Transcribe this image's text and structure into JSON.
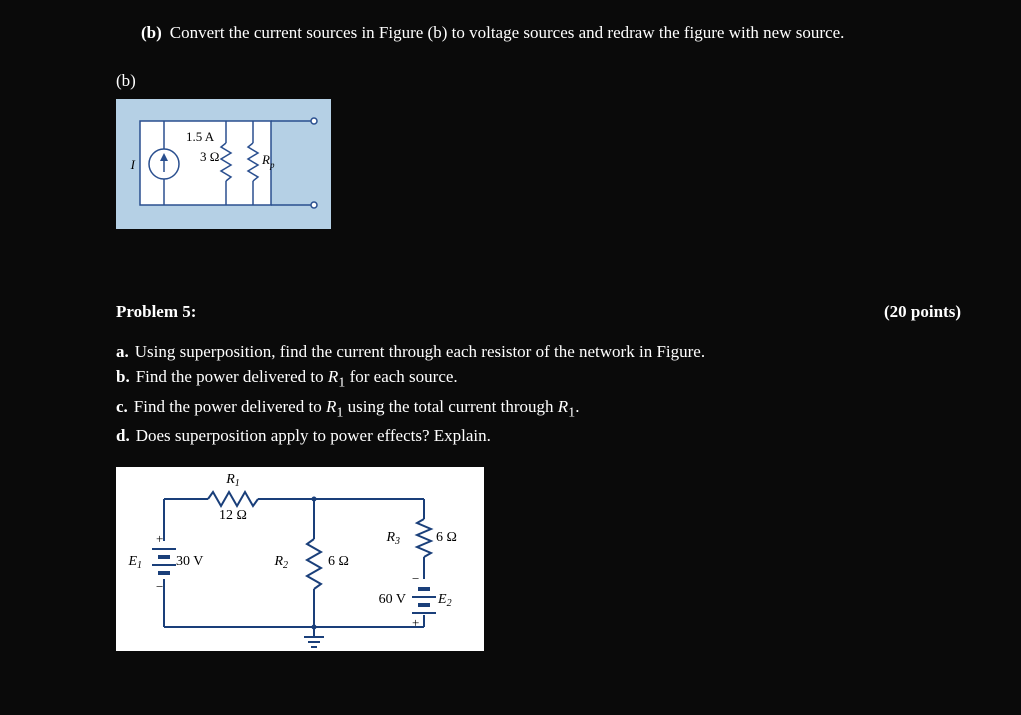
{
  "partB": {
    "tag": "(b)",
    "text": "Convert the current sources in Figure (b) to voltage sources and redraw the figure with new source."
  },
  "figLabelB": "(b)",
  "figureB": {
    "currentLabel": "1.5 A",
    "srcLabel": "I",
    "resistorValue": "3 Ω",
    "resistorName": "R",
    "resistorSub": "p"
  },
  "problem5": {
    "title": "Problem 5:",
    "pointsUnderline": "   ",
    "points": "(20 points)",
    "a": {
      "tag": "a.",
      "text": "Using superposition, find the current through each resistor of the network in Figure."
    },
    "b": {
      "tag": "b.",
      "text_pre": "Find the power delivered to ",
      "r1": "R",
      "r1sub": "1",
      "text_post": " for each source."
    },
    "c": {
      "tag": "c.",
      "text_pre": "Find the power delivered to ",
      "r1": "R",
      "r1sub": "1",
      "text_mid": " using the total current through ",
      "r1b": "R",
      "r1bsub": "1",
      "text_post": "."
    },
    "d": {
      "tag": "d.",
      "text": "Does superposition apply to power effects? Explain."
    }
  },
  "figureP5": {
    "R1": "R",
    "R1sub": "1",
    "R1val": "12 Ω",
    "R2": "R",
    "R2sub": "2",
    "R2val": "6 Ω",
    "R3": "R",
    "R3sub": "3",
    "R3val": "6 Ω",
    "E1": "E",
    "E1sub": "1",
    "E1val": "30 V",
    "E2": "E",
    "E2sub": "2",
    "E2val": "60 V"
  }
}
